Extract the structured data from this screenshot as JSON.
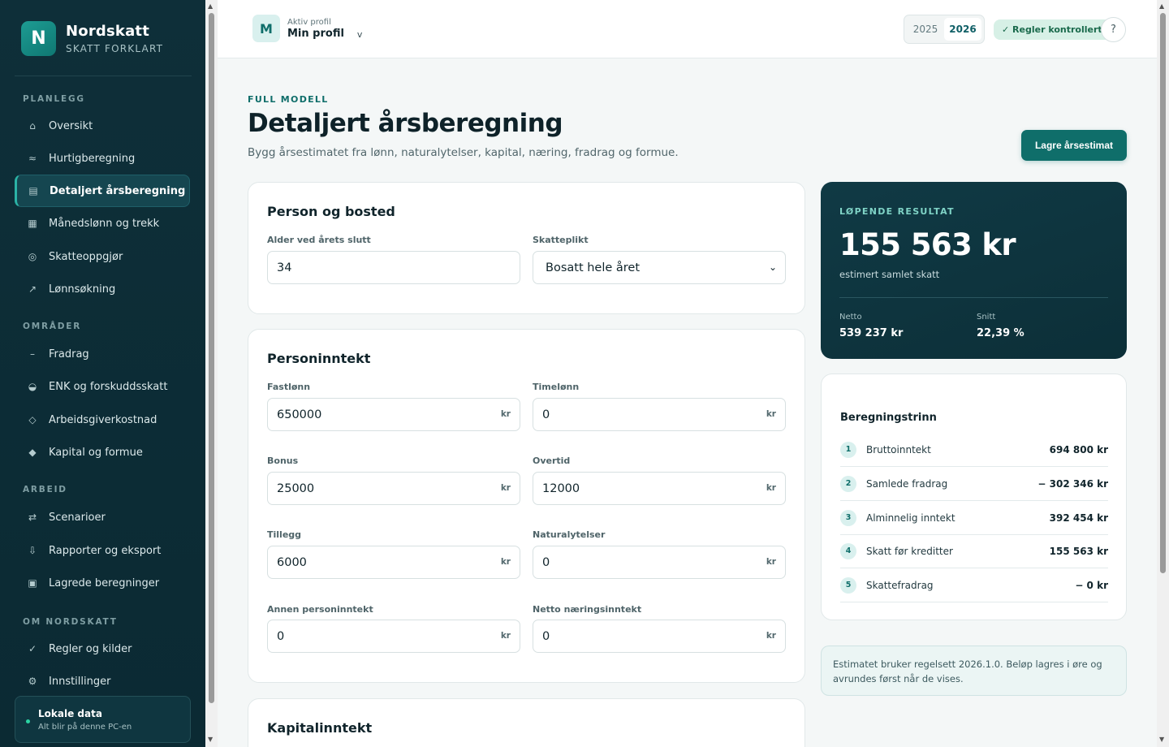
{
  "brand": {
    "logo_letter": "N",
    "name": "Nordskatt",
    "tagline": "SKATT FORKLART"
  },
  "sidebar": {
    "sections": [
      {
        "label": "PLANLEGG",
        "items": [
          {
            "label": "Oversikt",
            "icon": "⌂"
          },
          {
            "label": "Hurtigberegning",
            "icon": "≈"
          },
          {
            "label": "Detaljert årsberegning",
            "icon": "▤",
            "active": true
          },
          {
            "label": "Månedslønn og trekk",
            "icon": "▦"
          },
          {
            "label": "Skatteoppgjør",
            "icon": "◎"
          },
          {
            "label": "Lønnsøkning",
            "icon": "↗"
          }
        ]
      },
      {
        "label": "OMRÅDER",
        "items": [
          {
            "label": "Fradrag",
            "icon": "–"
          },
          {
            "label": "ENK og forskuddsskatt",
            "icon": "◒"
          },
          {
            "label": "Arbeidsgiverkostnad",
            "icon": "◇"
          },
          {
            "label": "Kapital og formue",
            "icon": "◆"
          }
        ]
      },
      {
        "label": "ARBEID",
        "items": [
          {
            "label": "Scenarioer",
            "icon": "⇄"
          },
          {
            "label": "Rapporter og eksport",
            "icon": "⇩"
          },
          {
            "label": "Lagrede beregninger",
            "icon": "▣"
          }
        ]
      },
      {
        "label": "OM NORDSKATT",
        "items": [
          {
            "label": "Regler og kilder",
            "icon": "✓"
          },
          {
            "label": "Innstillinger",
            "icon": "⚙"
          }
        ]
      }
    ],
    "local": {
      "title": "Lokale data",
      "subtitle": "Alt blir på denne PC-en"
    }
  },
  "topbar": {
    "avatar_letter": "M",
    "profile_label": "Aktiv profil",
    "profile_name": "Min profil",
    "profile_chevron": "v",
    "years": [
      "2025",
      "2026"
    ],
    "active_year": "2026",
    "rules_badge": "✓ Regler kontrollert",
    "help": "?"
  },
  "header": {
    "eyebrow": "FULL MODELL",
    "title": "Detaljert årsberegning",
    "subtitle": "Bygg årsestimatet fra lønn, naturalytelser, kapital, næring, fradrag og formue.",
    "save_label": "Lagre årsestimat"
  },
  "person": {
    "title": "Person og bosted",
    "age_label": "Alder ved årets slutt",
    "age_value": "34",
    "liability_label": "Skatteplikt",
    "liability_value": "Bosatt hele året"
  },
  "income": {
    "title": "Personinntekt",
    "unit": "kr",
    "fields": [
      {
        "label": "Fastlønn",
        "value": "650000"
      },
      {
        "label": "Timelønn",
        "value": "0"
      },
      {
        "label": "Bonus",
        "value": "25000"
      },
      {
        "label": "Overtid",
        "value": "12000"
      },
      {
        "label": "Tillegg",
        "value": "6000"
      },
      {
        "label": "Naturalytelser",
        "value": "0"
      },
      {
        "label": "Annen personinntekt",
        "value": "0"
      },
      {
        "label": "Netto næringsinntekt",
        "value": "0"
      }
    ]
  },
  "capital": {
    "title": "Kapitalinntekt"
  },
  "result": {
    "eyebrow": "LØPENDE RESULTAT",
    "total": "155 563 kr",
    "total_label": "estimert samlet skatt",
    "net_label": "Netto",
    "net_value": "539 237 kr",
    "avg_label": "Snitt",
    "avg_value": "22,39 %"
  },
  "steps": {
    "title": "Beregningstrinn",
    "rows": [
      {
        "num": "1",
        "label": "Bruttoinntekt",
        "value": "694 800 kr"
      },
      {
        "num": "2",
        "label": "Samlede fradrag",
        "value": "− 302 346 kr"
      },
      {
        "num": "3",
        "label": "Alminnelig inntekt",
        "value": "392 454 kr"
      },
      {
        "num": "4",
        "label": "Skatt før kreditter",
        "value": "155 563 kr"
      },
      {
        "num": "5",
        "label": "Skattefradrag",
        "value": "− 0 kr"
      }
    ]
  },
  "note": "Estimatet bruker regelsett 2026.1.0. Beløp lagres i øre og avrundes først når de vises."
}
